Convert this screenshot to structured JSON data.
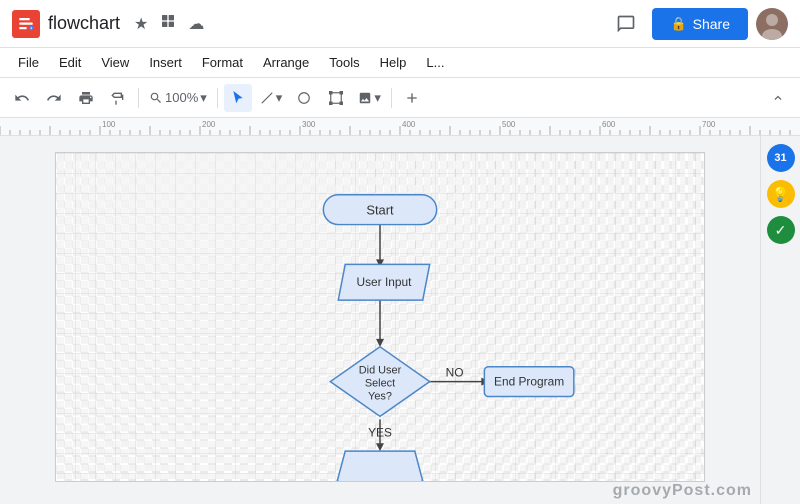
{
  "titleBar": {
    "appName": "flowchart",
    "starIcon": "★",
    "driveIcon": "⬜",
    "cloudIcon": "☁",
    "chatIcon": "💬",
    "shareLabel": "Share",
    "lockIcon": "🔒"
  },
  "menuBar": {
    "items": [
      "File",
      "Edit",
      "View",
      "Insert",
      "Format",
      "Arrange",
      "Tools",
      "Help",
      "L..."
    ]
  },
  "toolbar": {
    "undo": "↩",
    "redo": "↪",
    "print": "🖨",
    "paintFormat": "🖌",
    "zoom": "100%",
    "zoomArrow": "▾",
    "collapseIcon": "^"
  },
  "flowchart": {
    "startLabel": "Start",
    "userInputLabel": "User Input",
    "decisionLabel1": "Did User",
    "decisionLabel2": "Select",
    "decisionLabel3": "Yes?",
    "noLabel": "NO",
    "yesLabel": "YES",
    "endProgramLabel": "End Program"
  },
  "sidebar": {
    "calendarLabel": "31",
    "bulbLabel": "💡",
    "checkLabel": "✓"
  },
  "watermark": {
    "text": "groovyPost.com"
  }
}
